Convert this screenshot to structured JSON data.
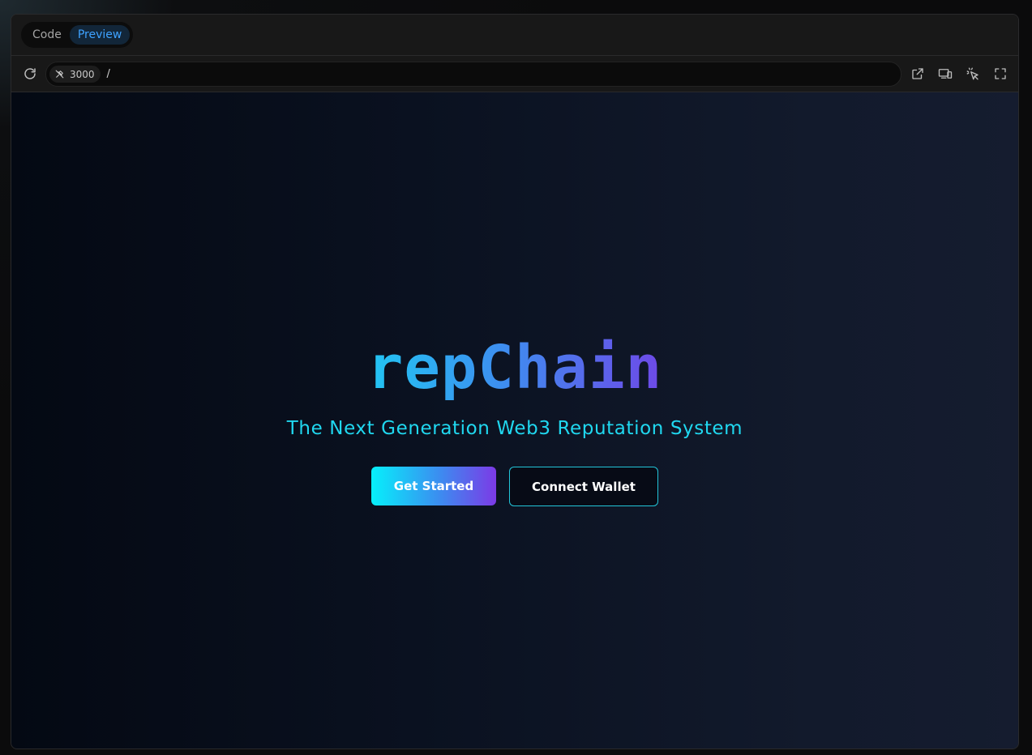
{
  "tabs": [
    {
      "label": "Code",
      "active": false
    },
    {
      "label": "Preview",
      "active": true
    }
  ],
  "toolbar": {
    "port": "3000",
    "path": "/"
  },
  "icons": {
    "refresh": "refresh-icon",
    "port": "plug-icon",
    "open_external": "external-link-icon",
    "responsive": "device-toggle-icon",
    "inspect": "cursor-select-icon",
    "fullscreen": "fullscreen-icon"
  },
  "hero": {
    "logo": "repChain",
    "tagline": "The Next Generation Web3 Reputation System",
    "primary_button": "Get Started",
    "secondary_button": "Connect Wallet"
  },
  "colors": {
    "tab_active_text": "#3ea2ff",
    "tagline": "#20d8f0",
    "logo_gradient_start": "#22c5f3",
    "logo_gradient_end": "#6e49e8",
    "button_gradient_start": "#06f0fb",
    "button_gradient_end": "#7c3ae6",
    "secondary_border": "#22c5d9"
  }
}
